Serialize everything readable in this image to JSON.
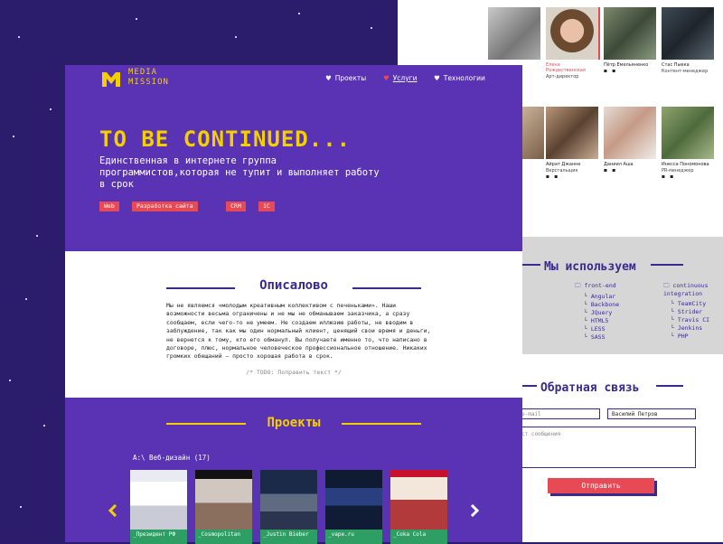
{
  "team": [
    {
      "name": "",
      "role": ""
    },
    {
      "name": "Елена Рождественская",
      "role": "Арт-директор"
    },
    {
      "name": "Пётр Емельяненко",
      "role": ""
    },
    {
      "name": "Стас Пыека",
      "role": "Контент-менеджер"
    },
    {
      "name": "",
      "role": ""
    },
    {
      "name": "",
      "role": ""
    },
    {
      "name": "Айрат Джанне",
      "role": "Верстальщик"
    },
    {
      "name": "Даниил Аша",
      "role": ""
    },
    {
      "name": "Инесса Пономонова",
      "role": "PR-менеджер"
    }
  ],
  "uses": {
    "title": "Мы используем",
    "frontend_label": "front-end",
    "frontend_items": [
      "Angular",
      "Backbone",
      "JQuery",
      "HTML5",
      "LESS",
      "SASS"
    ],
    "ci_label": "continuous integration",
    "ci_items": [
      "TeamCity",
      "Strider",
      "Travis CI",
      "Jenkins",
      "PHP"
    ]
  },
  "feedback": {
    "title": "Обратная связь",
    "email_placeholder": "e-mail",
    "name_value": "Василий Петров",
    "message_placeholder": "ст сообщения",
    "send_label": "Отправить"
  },
  "logo": {
    "line1": "MEDIA",
    "line2": "MISSION"
  },
  "nav": [
    {
      "label": "Проекты"
    },
    {
      "label": "Услуги"
    },
    {
      "label": "Технологии"
    }
  ],
  "hero": {
    "title": "TO BE CONTINUED...",
    "subtitle": "Единственная в интернете группа программистов,которая не тупит и выполняет работу в срок",
    "tags": [
      "Web",
      "Разработка сайта",
      "CRM",
      "1С"
    ]
  },
  "about": {
    "title": "Описалово",
    "text": "Мы не являемся «молодым креативным коллективом с печеньками». Наши возможности весьма ограничены и не мы не обманываем заказчика, а сразу сообщаем, если чего-то не умеем. Не создаем иллюзию работы, не вводим в заблуждение, так как мы один нормальный клиент, ценящий свои время и деньги, не вернется к тому, кто его обманул. Вы получаете именно то, что написано в договоре, плюс, нормальное человеческое профессиональное отношение. Никаких громких обещаний – просто хорошая работа в срок.",
    "todo": "/* TODO: Поправить текст */"
  },
  "projects": {
    "title": "Проекты",
    "crumb": "A:\\ Веб-дизайн (17)",
    "cards": [
      {
        "label": "_Президент РФ"
      },
      {
        "label": "_Cosmopolitan"
      },
      {
        "label": "_Justin Bieber"
      },
      {
        "label": "_vape.ru"
      },
      {
        "label": "_Coka Cola"
      }
    ]
  },
  "colors": {
    "accent": "#f5d000",
    "purple": "#5a32b4",
    "red": "#e84a55",
    "green": "#2f9e65"
  }
}
